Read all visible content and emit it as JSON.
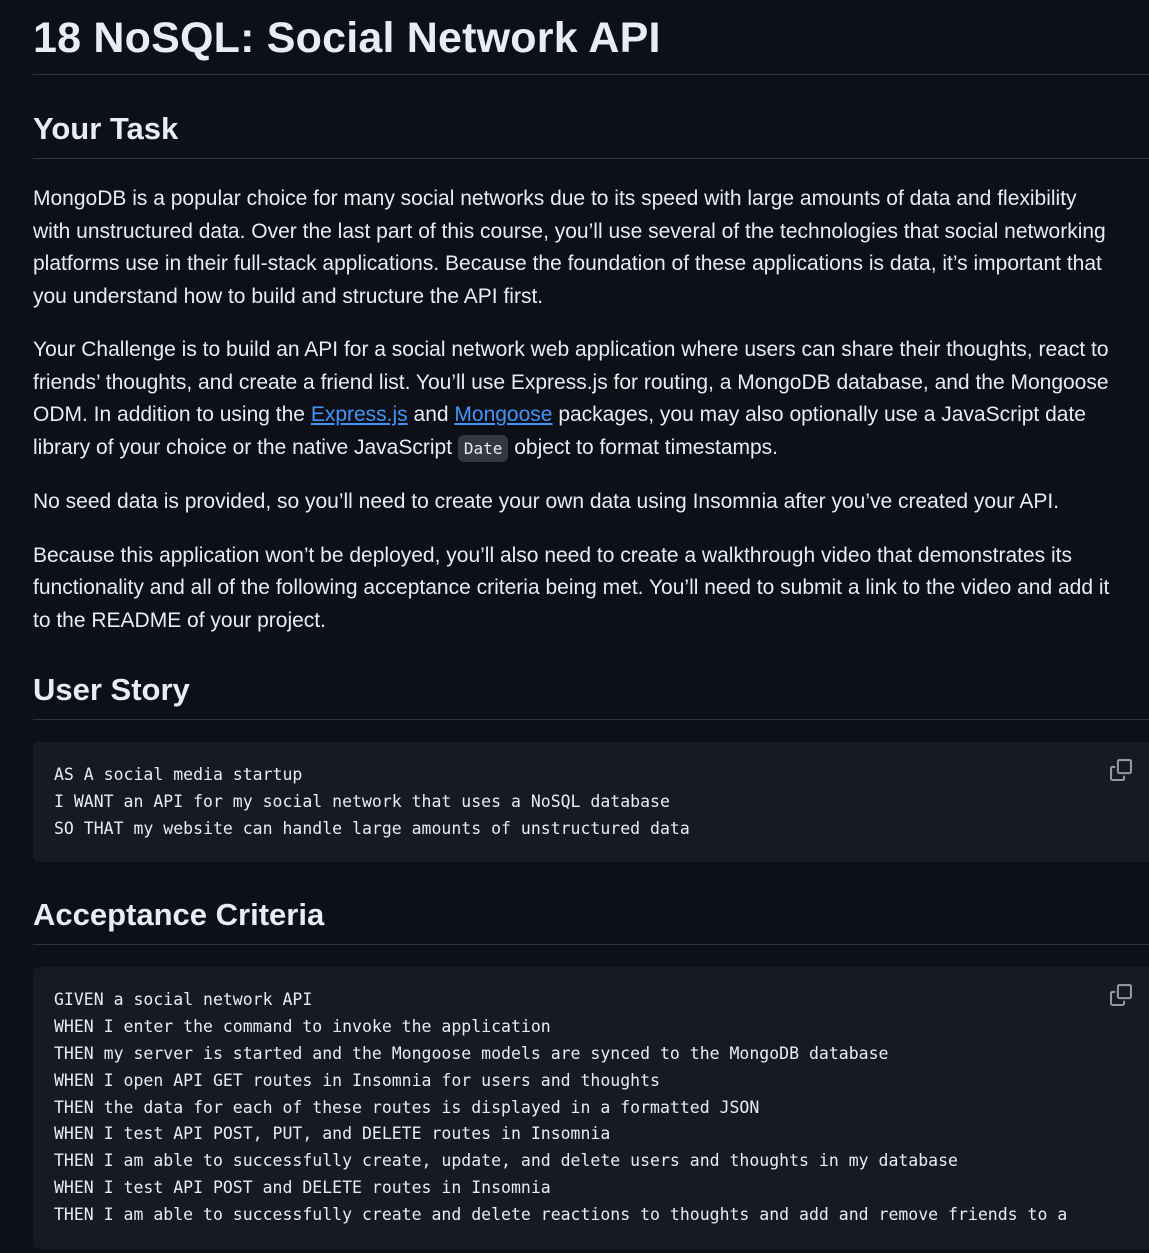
{
  "title": "18 NoSQL: Social Network API",
  "sections": {
    "task": {
      "heading": "Your Task",
      "p1": [
        "MongoDB is a popular choice for many social networks due to its speed with large amounts of data and flexibility",
        "with unstructured data. Over the last part of this course, you’ll use several of the technologies that social networking",
        "platforms use in their full-stack applications. Because the foundation of these applications is data, it’s important that",
        "you understand how to build and structure the API first."
      ],
      "p2": {
        "line1": "Your Challenge is to build an API for a social network web application where users can share their thoughts, react to",
        "line2": "friends’ thoughts, and create a friend list. You’ll use Express.js for routing, a MongoDB database, and the Mongoose",
        "line3_before": "ODM. In addition to using the ",
        "link_express": "Express.js",
        "line3_and": " and ",
        "link_mongoose": "Mongoose",
        "line3_after": " packages, you may also optionally use a JavaScript date",
        "line4_before": "library of your choice or the native JavaScript ",
        "inline_code": "Date",
        "line4_after": " object to format timestamps."
      },
      "p3": "No seed data is provided, so you’ll need to create your own data using Insomnia after you’ve created your API.",
      "p4": [
        "Because this application won’t be deployed, you’ll also need to create a walkthrough video that demonstrates its",
        "functionality and all of the following acceptance criteria being met. You’ll need to submit a link to the video and add it",
        "to the README of your project."
      ]
    },
    "story": {
      "heading": "User Story",
      "code": [
        "AS A social media startup",
        "I WANT an API for my social network that uses a NoSQL database",
        "SO THAT my website can handle large amounts of unstructured data"
      ]
    },
    "criteria": {
      "heading": "Acceptance Criteria",
      "code": [
        "GIVEN a social network API",
        "WHEN I enter the command to invoke the application",
        "THEN my server is started and the Mongoose models are synced to the MongoDB database",
        "WHEN I open API GET routes in Insomnia for users and thoughts",
        "THEN the data for each of these routes is displayed in a formatted JSON",
        "WHEN I test API POST, PUT, and DELETE routes in Insomnia",
        "THEN I am able to successfully create, update, and delete users and thoughts in my database",
        "WHEN I test API POST and DELETE routes in Insomnia",
        "THEN I am able to successfully create and delete reactions to thoughts and add and remove friends to a"
      ]
    }
  },
  "icons": {
    "copy": "copy-icon"
  },
  "colors": {
    "background": "#0d1117",
    "text": "#e6edf3",
    "link": "#4493f8",
    "code_block_bg": "#161b22",
    "border": "#30363d"
  }
}
